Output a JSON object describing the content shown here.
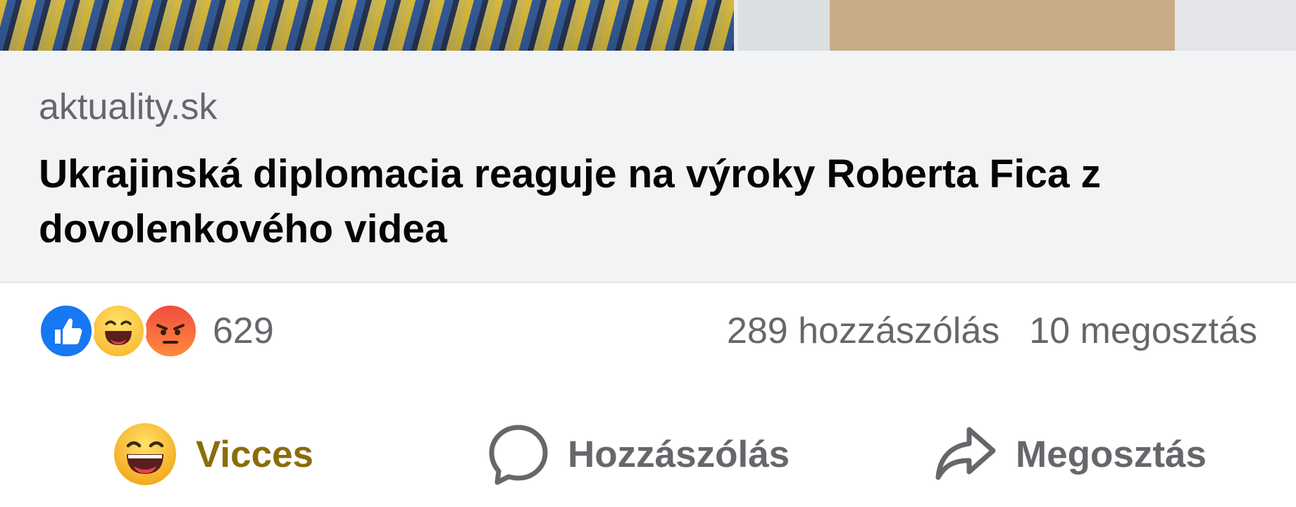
{
  "link_preview": {
    "domain": "aktuality.sk",
    "headline": "Ukrajinská diplomacia reaguje na výroky Roberta Fica z dovolenkového videa"
  },
  "reactions": {
    "icons": [
      "like-icon",
      "haha-icon",
      "angry-icon"
    ],
    "count": "629"
  },
  "stats": {
    "comments": "289 hozzászólás",
    "shares": "10 megosztás"
  },
  "actions": {
    "react_label": "Vicces",
    "comment_label": "Hozzászólás",
    "share_label": "Megosztás"
  },
  "colors": {
    "like_blue": "#1877f2",
    "haha_yellow": "#f7b125",
    "angry_red": "#f04e3e",
    "vicces_text": "#8a6d0b",
    "secondary_text": "#65676b",
    "card_bg": "#f2f3f5"
  }
}
